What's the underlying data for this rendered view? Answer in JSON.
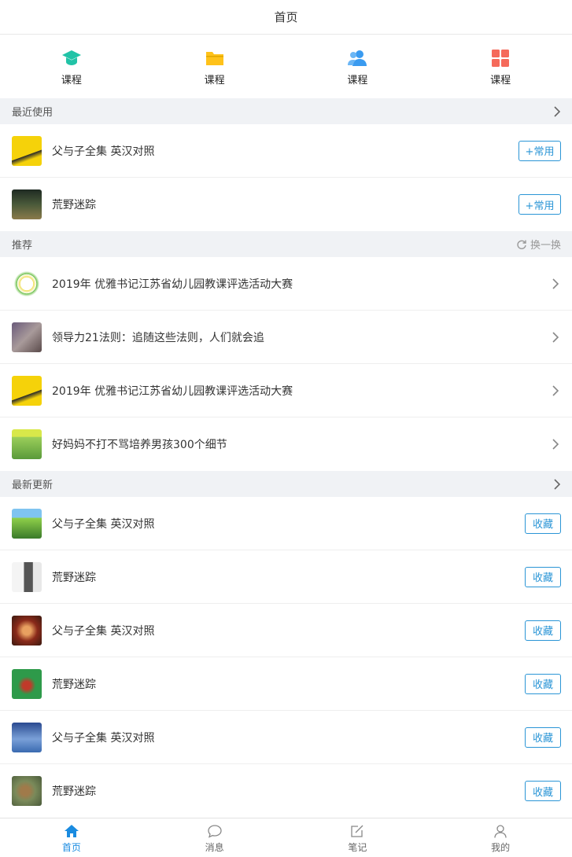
{
  "header": {
    "title": "首页"
  },
  "quick_nav": [
    {
      "label": "课程",
      "icon": "graduation-cap-icon",
      "color": "#22c3a7"
    },
    {
      "label": "课程",
      "icon": "folder-icon",
      "color": "#ffc21a"
    },
    {
      "label": "课程",
      "icon": "users-icon",
      "color": "#3a9bf0"
    },
    {
      "label": "课程",
      "icon": "grid-icon",
      "color": "#f56a5b"
    }
  ],
  "recent": {
    "title": "最近使用",
    "items": [
      {
        "title": "父与子全集 英汉对照",
        "action": "+常用",
        "thumb_color": "#f5d20a"
      },
      {
        "title": "荒野迷踪",
        "action": "+常用",
        "thumb_color": "#3a4a3a"
      }
    ]
  },
  "recommend": {
    "title": "推荐",
    "refresh_label": "换一换",
    "items": [
      {
        "title": "2019年 优雅书记江苏省幼儿园教课评选活动大赛",
        "thumb_color": "#f2f2f2"
      },
      {
        "title": "领导力21法则：追随这些法则，人们就会追",
        "thumb_color": "#8a7a8a"
      },
      {
        "title": "2019年 优雅书记江苏省幼儿园教课评选活动大赛",
        "thumb_color": "#f5d20a"
      },
      {
        "title": "好妈妈不打不骂培养男孩300个细节",
        "thumb_color": "#9bcf5a"
      }
    ]
  },
  "latest": {
    "title": "最新更新",
    "items": [
      {
        "title": "父与子全集 英汉对照",
        "action": "收藏",
        "thumb_color": "#5fb54a"
      },
      {
        "title": "荒野迷踪",
        "action": "收藏",
        "thumb_color": "#e4e4e4"
      },
      {
        "title": "父与子全集 英汉对照",
        "action": "收藏",
        "thumb_color": "#8a2a1a"
      },
      {
        "title": "荒野迷踪",
        "action": "收藏",
        "thumb_color": "#2e9a4a"
      },
      {
        "title": "父与子全集 英汉对照",
        "action": "收藏",
        "thumb_color": "#3a6ab0"
      },
      {
        "title": "荒野迷踪",
        "action": "收藏",
        "thumb_color": "#7a8a5a"
      }
    ]
  },
  "tabbar": [
    {
      "label": "首页",
      "icon": "home-icon",
      "active": true
    },
    {
      "label": "消息",
      "icon": "message-icon",
      "active": false
    },
    {
      "label": "笔记",
      "icon": "edit-icon",
      "active": false
    },
    {
      "label": "我的",
      "icon": "user-icon",
      "active": false
    }
  ],
  "colors": {
    "accent": "#2a95d6",
    "tab_active": "#1a8be0",
    "section_bg": "#f0f2f5"
  }
}
